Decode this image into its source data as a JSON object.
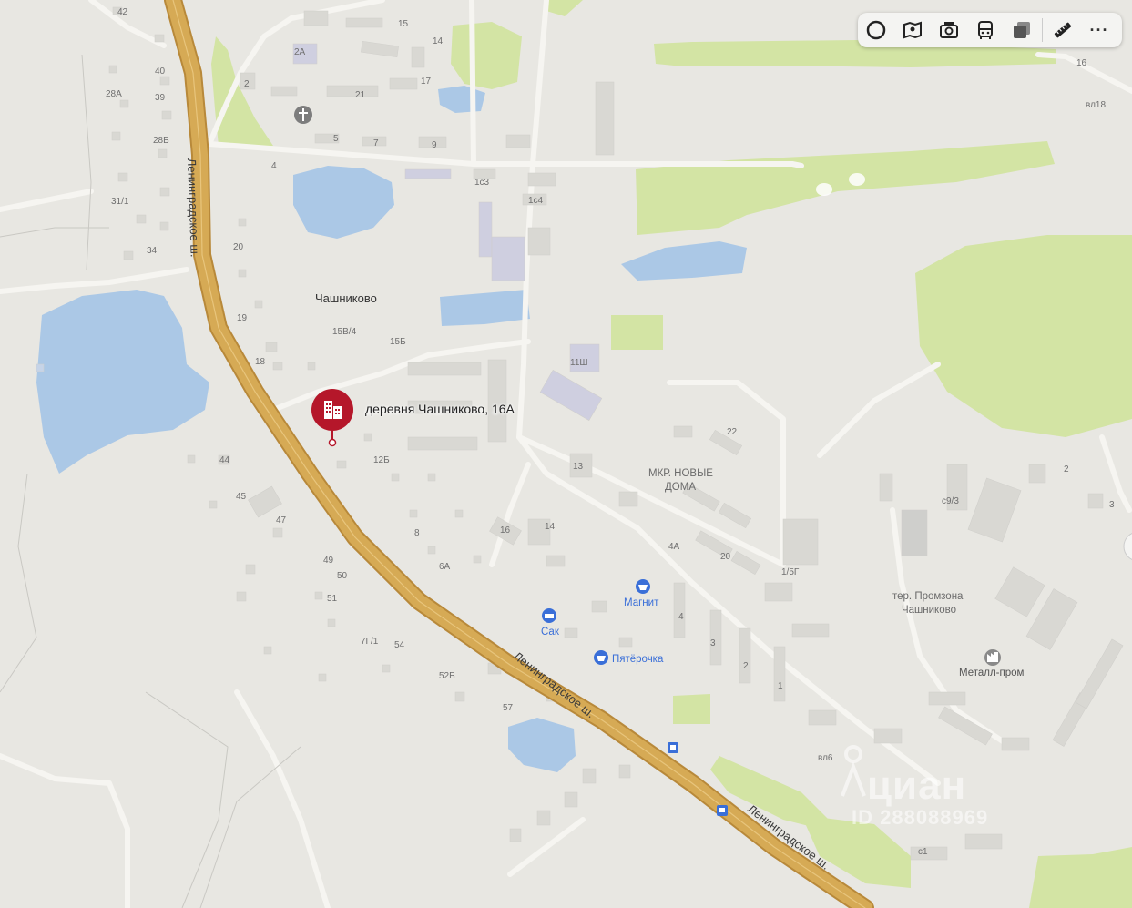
{
  "toolbar": {
    "buttons": [
      {
        "name": "layers-icon"
      },
      {
        "name": "panorama-icon"
      },
      {
        "name": "camera-icon"
      },
      {
        "name": "transit-icon"
      },
      {
        "name": "map-layers-icon"
      },
      {
        "name": "ruler-icon"
      }
    ],
    "more_label": "···"
  },
  "marker": {
    "label": "деревня Чашниково, 16А",
    "color": "#b5172a",
    "icon": "building-icon"
  },
  "place_labels": {
    "village": "Чашниково",
    "district": [
      "МКР. НОВЫЕ",
      "ДОМА"
    ],
    "industrial": [
      "тер. Промзона",
      "Чашниково"
    ],
    "road": "Ленинградское ш."
  },
  "poi": {
    "magnit": "Магнит",
    "pyaterochka": "Пятёрочка",
    "sak": "Сак",
    "metallprom": "Металл-пром"
  },
  "house_numbers": {
    "n42": "42",
    "n40": "40",
    "n39": "39",
    "n28a": "28А",
    "n28b": "28Б",
    "n311": "31/1",
    "n34": "34",
    "n15": "15",
    "n14": "14",
    "n2a": "2А",
    "n2": "2",
    "n21": "21",
    "n17": "17",
    "n5": "5",
    "n7": "7",
    "n9": "9",
    "n4": "4",
    "n1s3": "1с3",
    "n1s4": "1с4",
    "n20": "20",
    "n19": "19",
    "n18": "18",
    "n15v4": "15В/4",
    "n15b": "15Б",
    "n11sh": "11Ш",
    "n22": "22",
    "n44": "44",
    "n45": "45",
    "n47": "47",
    "n12b": "12Б",
    "n13": "13",
    "n16": "16",
    "n14b": "14",
    "n8": "8",
    "n6a": "6А",
    "n49": "49",
    "n50": "50",
    "n51": "51",
    "n7g1": "7Г/1",
    "n54": "54",
    "n52b": "52Б",
    "n57": "57",
    "n4a": "4А",
    "n20b": "20",
    "n15g": "1/5Г",
    "n4b": "4",
    "n3": "3",
    "n2b": "2",
    "n1": "1",
    "n16r": "16",
    "nvl18": "вл18",
    "nvl6": "вл6",
    "n2r": "2",
    "n3r": "3",
    "ns93": "с9/3",
    "ns1": "с1"
  },
  "watermark": {
    "name": "циан",
    "id": "ID 288088969"
  },
  "colors": {
    "water": "#abc8e6",
    "park": "#d3e4a5",
    "road_main": "#d6aa55",
    "road_edge": "#b8893a"
  }
}
